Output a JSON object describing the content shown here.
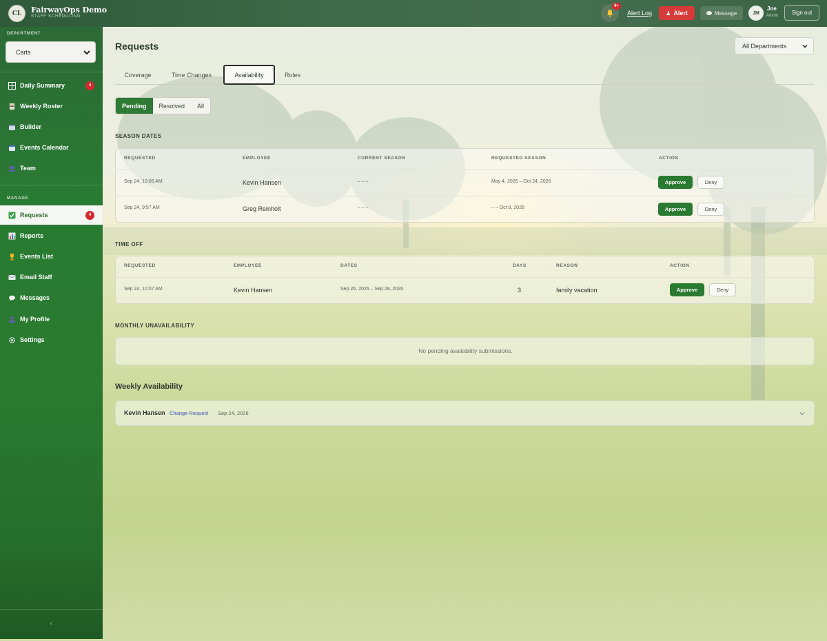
{
  "colors": {
    "brand_green": "#2b7a31",
    "alert_red": "#d83a3a",
    "badge_red": "#d3282d",
    "link_blue": "#3b55b5"
  },
  "header": {
    "logo_initials": "CL",
    "app_title": "FairwayOps Demo",
    "app_subtitle": "STAFF SCHEDULING",
    "notification_badge": "9+",
    "alert_log_label": "Alert Log",
    "alert_label": "Alert",
    "message_label": "Message",
    "user_initials": "JM",
    "user_name": "Joe",
    "user_role": "Admin",
    "signout_label": "Sign out"
  },
  "sidebar": {
    "department_label": "DEPARTMENT",
    "department_value": "Carts",
    "nav_items": [
      {
        "label": "Daily Summary",
        "icon": "grid-icon",
        "badge": "4"
      },
      {
        "label": "Weekly Roster",
        "icon": "roster-icon"
      },
      {
        "label": "Builder",
        "icon": "builder-icon"
      },
      {
        "label": "Events Calendar",
        "icon": "calendar-icon"
      },
      {
        "label": "Team",
        "icon": "team-icon"
      }
    ],
    "manage_label": "MANAGE",
    "manage_items": [
      {
        "label": "Requests",
        "icon": "check-icon",
        "badge": "4",
        "active": true
      },
      {
        "label": "Reports",
        "icon": "chart-icon"
      },
      {
        "label": "Events List",
        "icon": "trophy-icon"
      },
      {
        "label": "Email Staff",
        "icon": "email-icon"
      },
      {
        "label": "Messages",
        "icon": "chat-icon"
      },
      {
        "label": "My Profile",
        "icon": "person-icon"
      },
      {
        "label": "Settings",
        "icon": "gear-icon"
      }
    ],
    "collapse_glyph": "‹"
  },
  "main": {
    "title": "Requests",
    "department_filter": "All Departments",
    "tabs": [
      "Coverage",
      "Time Changes",
      "Availability",
      "Roles"
    ],
    "active_tab": "Availability",
    "status_filters": [
      "Pending",
      "Resolved",
      "All"
    ],
    "season_dates": {
      "heading": "SEASON DATES",
      "columns": [
        "REQUESTED",
        "EMPLOYEE",
        "CURRENT SEASON",
        "REQUESTED SEASON",
        "ACTION"
      ],
      "rows": [
        {
          "requested": "Sep 24, 10:06 AM",
          "employee": "Kevin Hansen",
          "current_season": "– – –",
          "requested_season": "May 4, 2026 – Oct 24, 2026"
        },
        {
          "requested": "Sep 24, 9:57 AM",
          "employee": "Greg Reinholt",
          "current_season": "– – –",
          "requested_season": "– – Oct 8, 2026"
        }
      ]
    },
    "time_off": {
      "heading": "TIME OFF",
      "columns": [
        "REQUESTED",
        "EMPLOYEE",
        "DATES",
        "DAYS",
        "REASON",
        "ACTION"
      ],
      "rows": [
        {
          "requested": "Sep 24, 10:07 AM",
          "employee": "Kevin Hansen",
          "dates": "Sep 26, 2026 – Sep 28, 2026",
          "days": "3",
          "reason": "family vacation"
        }
      ]
    },
    "monthly": {
      "heading": "MONTHLY UNAVAILABILITY",
      "empty_message": "No pending availability submissions."
    },
    "weekly": {
      "heading": "Weekly Availability",
      "employee": "Kevin Hansen",
      "link_label": "Change Request",
      "date": "Sep 24, 2026"
    },
    "approve_label": "Approve",
    "deny_label": "Deny"
  }
}
